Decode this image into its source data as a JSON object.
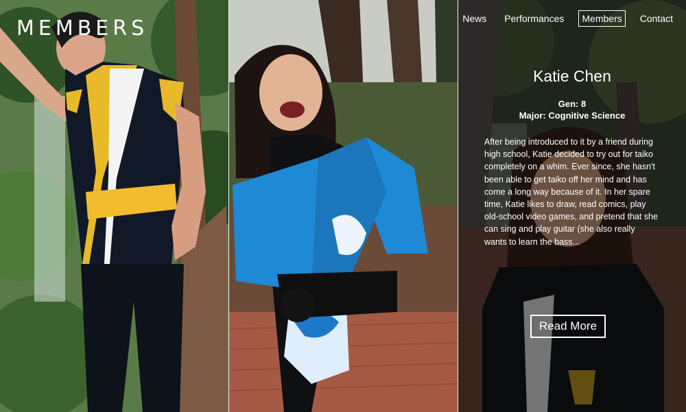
{
  "site": {
    "title": "MEMBERS"
  },
  "nav": {
    "items": [
      {
        "label": "News",
        "active": false
      },
      {
        "label": "Performances",
        "active": false
      },
      {
        "label": "Members",
        "active": true
      },
      {
        "label": "Contact",
        "active": false
      }
    ]
  },
  "member": {
    "name": "Katie Chen",
    "gen": "Gen: 8",
    "major": "Major: Cognitive Science",
    "bio": "After being introduced to it by a friend during high school, Katie decided to try out for taiko completely on a whim. Ever since, she hasn't been able to get taiko off her mind and has come a long way because of it. In her spare time, Katie likes to draw, read comics, play old-school video games, and pretend that she can sing and play guitar (she also really wants to learn the bass...",
    "read_more_label": "Read More"
  },
  "colors": {
    "happi_gold": "#f2c230",
    "happi_blue": "#1e88d4",
    "foliage_green": "#3f6a2a",
    "brick_red": "#8a4b3a"
  },
  "icons": {
    "photo_1": "member-photo",
    "photo_2": "member-photo",
    "photo_3": "member-photo"
  }
}
